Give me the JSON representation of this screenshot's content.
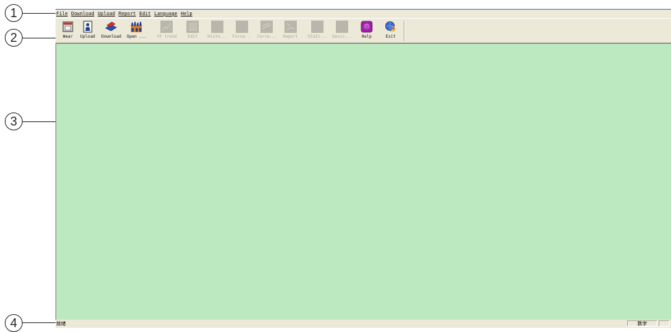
{
  "callouts": [
    {
      "number": "1"
    },
    {
      "number": "2"
    },
    {
      "number": "3"
    },
    {
      "number": "4"
    }
  ],
  "menu": [
    "File",
    "Download",
    "Upload",
    "Report",
    "Edit",
    "Language",
    "Help"
  ],
  "toolbar": [
    {
      "label": "Wear",
      "icon": "wear-icon",
      "enabled": true
    },
    {
      "label": "Upload",
      "icon": "upload-icon",
      "enabled": true
    },
    {
      "label": "Download",
      "icon": "download-icon",
      "enabled": true
    },
    {
      "label": "Open ...",
      "icon": "open-icon",
      "enabled": true
    },
    {
      "label": "XY trend",
      "icon": "xy-trend-icon",
      "enabled": false
    },
    {
      "label": "Edit",
      "icon": "edit-grid-icon",
      "enabled": false
    },
    {
      "label": "Histo...",
      "icon": "histogram-icon",
      "enabled": false
    },
    {
      "label": "Force...",
      "icon": "force-icon",
      "enabled": false
    },
    {
      "label": "Corre...",
      "icon": "correlation-icon",
      "enabled": false
    },
    {
      "label": "Report",
      "icon": "report-icon",
      "enabled": false
    },
    {
      "label": "Stati...",
      "icon": "statistics-icon",
      "enabled": false
    },
    {
      "label": "Devic...",
      "icon": "device-icon",
      "enabled": false
    },
    {
      "label": "Help",
      "icon": "help-icon",
      "enabled": true
    },
    {
      "label": "Exit",
      "icon": "exit-icon",
      "enabled": true
    }
  ],
  "status": {
    "text": "就绪",
    "numlock": "数字"
  },
  "colors": {
    "workspace": "#bde9c1",
    "chrome": "#ece9d8",
    "title_line": "#4a6cc0"
  }
}
